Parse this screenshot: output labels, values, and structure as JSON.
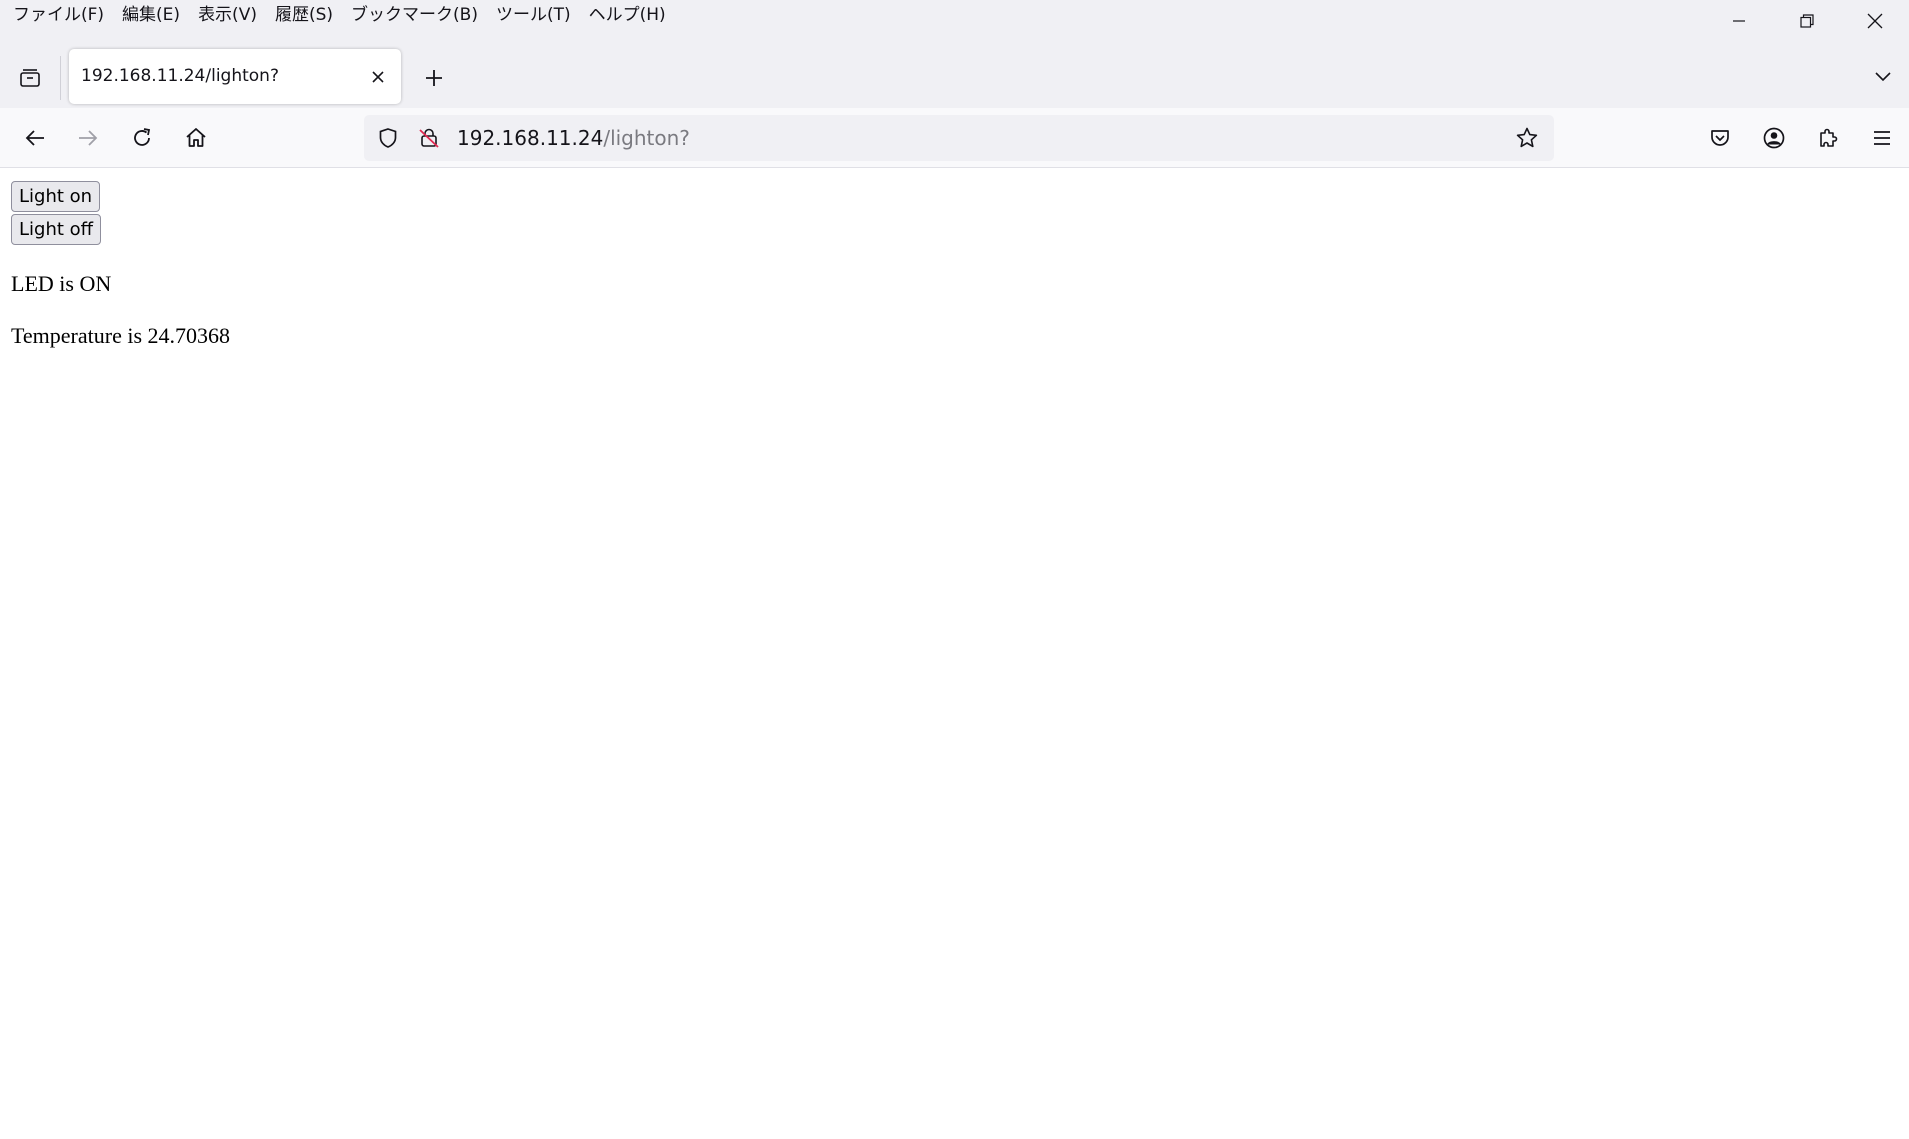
{
  "menu": {
    "items": [
      "ファイル(F)",
      "編集(E)",
      "表示(V)",
      "履歴(S)",
      "ブックマーク(B)",
      "ツール(T)",
      "ヘルプ(H)"
    ]
  },
  "tab": {
    "title": "192.168.11.24/lighton?"
  },
  "urlbar": {
    "host": "192.168.11.24",
    "path": "/lighton?"
  },
  "page": {
    "light_on_label": "Light on",
    "light_off_label": "Light off",
    "led_status": "LED is ON",
    "temperature_text": "Temperature is 24.70368"
  },
  "icons": {
    "tab_list": "tab-list-icon",
    "close_tab": "close-icon",
    "new_tab": "plus-icon",
    "tab_overflow": "chevron-down-icon",
    "back": "back-arrow-icon",
    "forward": "forward-arrow-icon",
    "reload": "reload-icon",
    "home": "home-icon",
    "tracking_protection": "shield-icon",
    "insecure": "insecure-lock-icon",
    "bookmark": "star-icon",
    "pocket": "pocket-icon",
    "account": "account-icon",
    "extensions": "puzzle-icon",
    "menu": "hamburger-menu-icon"
  },
  "colors": {
    "chrome_bg": "#f0f0f4",
    "toolbar_bg": "#f9f9fb",
    "button_bg": "#e9e9ed",
    "text": "#15141a",
    "url_path": "#7a7a80"
  }
}
